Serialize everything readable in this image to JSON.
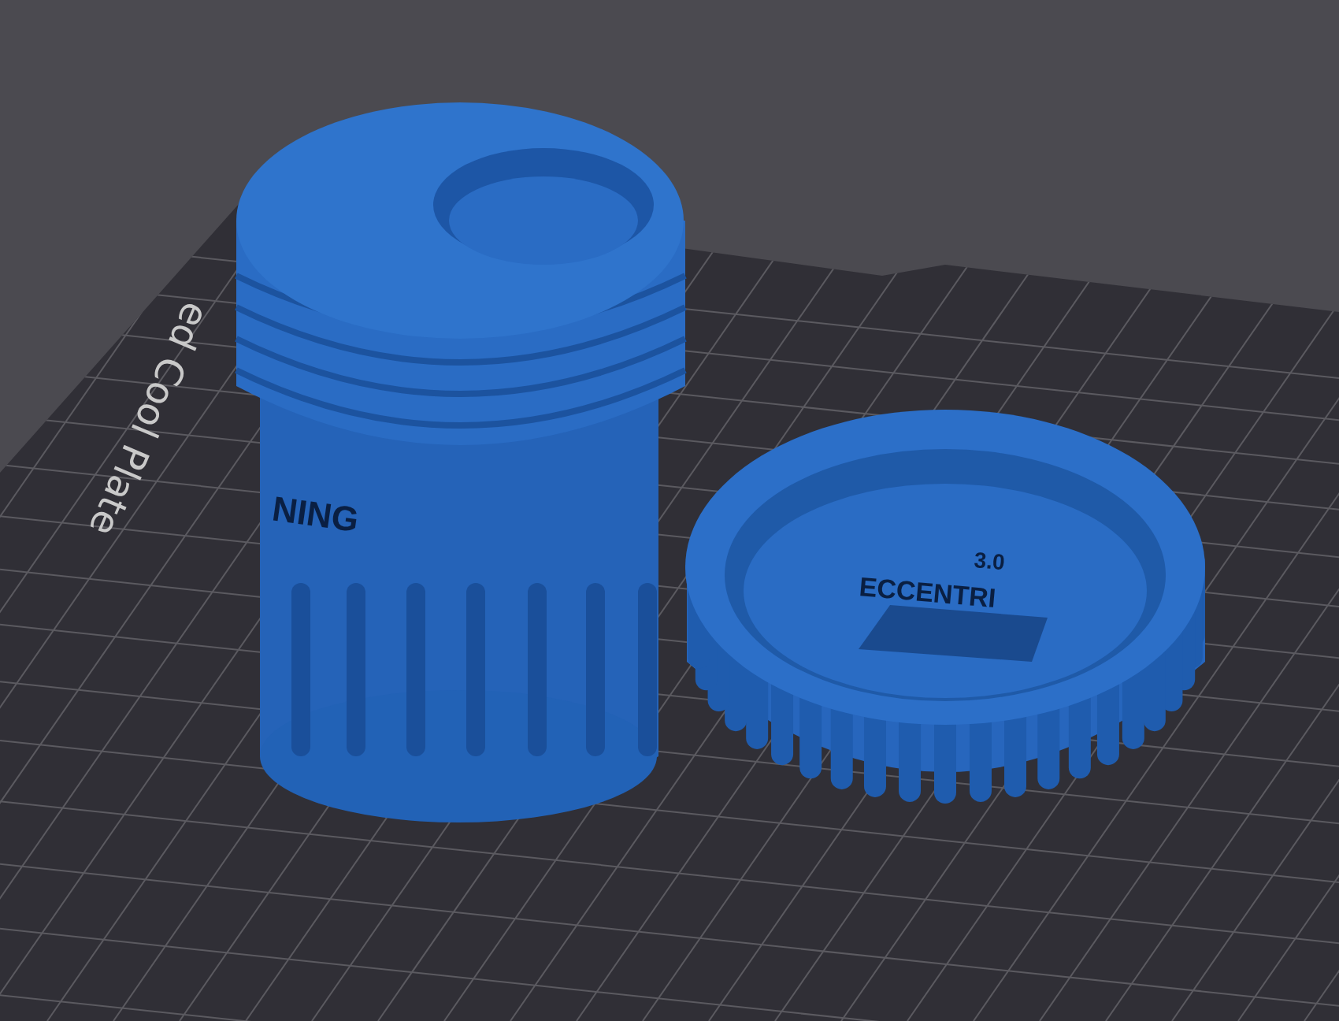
{
  "viewport": {
    "plate_label": "ed Cool Plate",
    "models": [
      {
        "kind": "jar",
        "texts": [
          "NING"
        ]
      },
      {
        "kind": "lid",
        "texts": [
          "3.0",
          "ECCENTRI"
        ]
      }
    ]
  }
}
